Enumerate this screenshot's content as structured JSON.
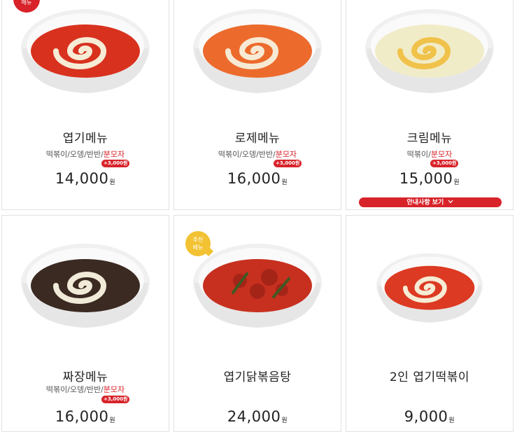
{
  "badges": {
    "menu": "메뉴",
    "recommended_line1": "추천",
    "recommended_line2": "메뉴"
  },
  "cards": [
    {
      "name": "엽기메뉴",
      "opt_plain": "떡볶이/오뎅/반반/",
      "opt_red": "분모자",
      "extra": "+3,000원",
      "price": "14,000",
      "won": "원",
      "sauce": "#d8321f",
      "spiral": "#f6ecd6"
    },
    {
      "name": "로제메뉴",
      "opt_plain": "떡볶이/오뎅/반반/",
      "opt_red": "분모자",
      "extra": "+3,000원",
      "price": "16,000",
      "won": "원",
      "sauce": "#ec6b2c",
      "spiral": "#f7ead4"
    },
    {
      "name": "크림메뉴",
      "opt_plain": "떡볶이/",
      "opt_red": "분모자",
      "extra": "+3,000원",
      "price": "15,000",
      "won": "원",
      "sauce": "#f1ecc8",
      "spiral": "#f0c24a"
    },
    {
      "name": "짜장메뉴",
      "opt_plain": "떡볶이/오뎅/반반/",
      "opt_red": "분모자",
      "extra": "+3,000원",
      "price": "16,000",
      "won": "원",
      "sauce": "#3a2a22",
      "spiral": "#f2ead8"
    },
    {
      "name": "엽기닭볶음탕",
      "price": "24,000",
      "won": "원",
      "sauce": "#c7301f",
      "spiral": "#a52418"
    },
    {
      "name": "2인 엽기떡볶이",
      "price": "9,000",
      "won": "원",
      "sauce": "#dc3a22",
      "spiral": "#f6ecd6"
    }
  ],
  "notice_button": {
    "label": "안내사항 보기",
    "icon": "chevron-down-icon"
  },
  "colors": {
    "accent_red": "#d8232a",
    "badge_yellow": "#f2c233",
    "border": "#e2e2e2"
  }
}
